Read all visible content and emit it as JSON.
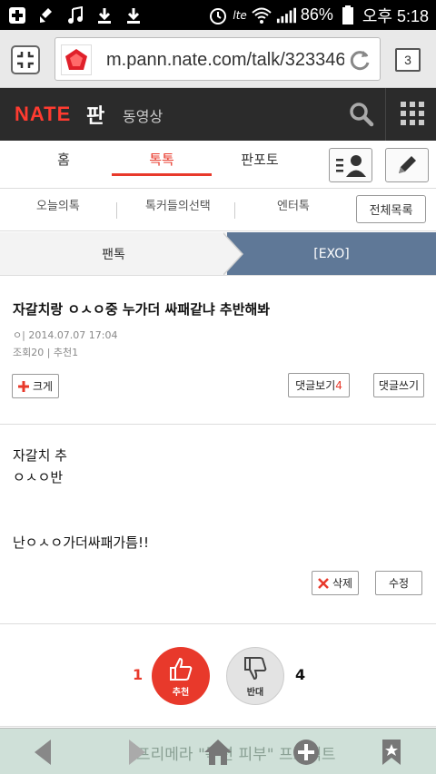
{
  "status_bar": {
    "battery": "86%",
    "time": "오후 5:18",
    "network": "lte"
  },
  "browser": {
    "url": "m.pann.nate.com/talk/323346",
    "tab_count": "3"
  },
  "header": {
    "logo": "NATE",
    "pann": "판",
    "video": "동영상"
  },
  "main_tabs": [
    {
      "label": "홈"
    },
    {
      "label": "톡톡"
    },
    {
      "label": "판포토"
    }
  ],
  "sub_tabs": [
    {
      "label": "오늘의톡"
    },
    {
      "label": "톡커들의선택"
    },
    {
      "label": "엔터톡"
    }
  ],
  "all_list": "전체목록",
  "category": {
    "left": "팬톡",
    "right": "[EXO]"
  },
  "post": {
    "title": "자갈치랑 ㅇㅅㅇ중 누가더 싸패같냐 추반해봐",
    "meta": "ㅇ| 2014.07.07 17:04",
    "stats": "조회20 | 추천1",
    "size_button": "크게",
    "view_comments_label": "댓글보기",
    "comment_count": "4",
    "write_comment": "댓글쓰기",
    "body": [
      "자갈치 추",
      "ㅇㅅㅇ반",
      "",
      "난ㅇㅅㅇ가더싸패가틈!!"
    ],
    "delete_button": "삭제",
    "edit_button": "수정"
  },
  "vote": {
    "up_count": "1",
    "up_label": "추천",
    "down_count": "4",
    "down_label": "반대"
  },
  "bottom_ad": "프리메라 \"목련 피부\" 프로젝트",
  "colors": {
    "accent": "#e8392b",
    "header_bg": "#2b2b2b",
    "category_bg": "#5f7897"
  }
}
